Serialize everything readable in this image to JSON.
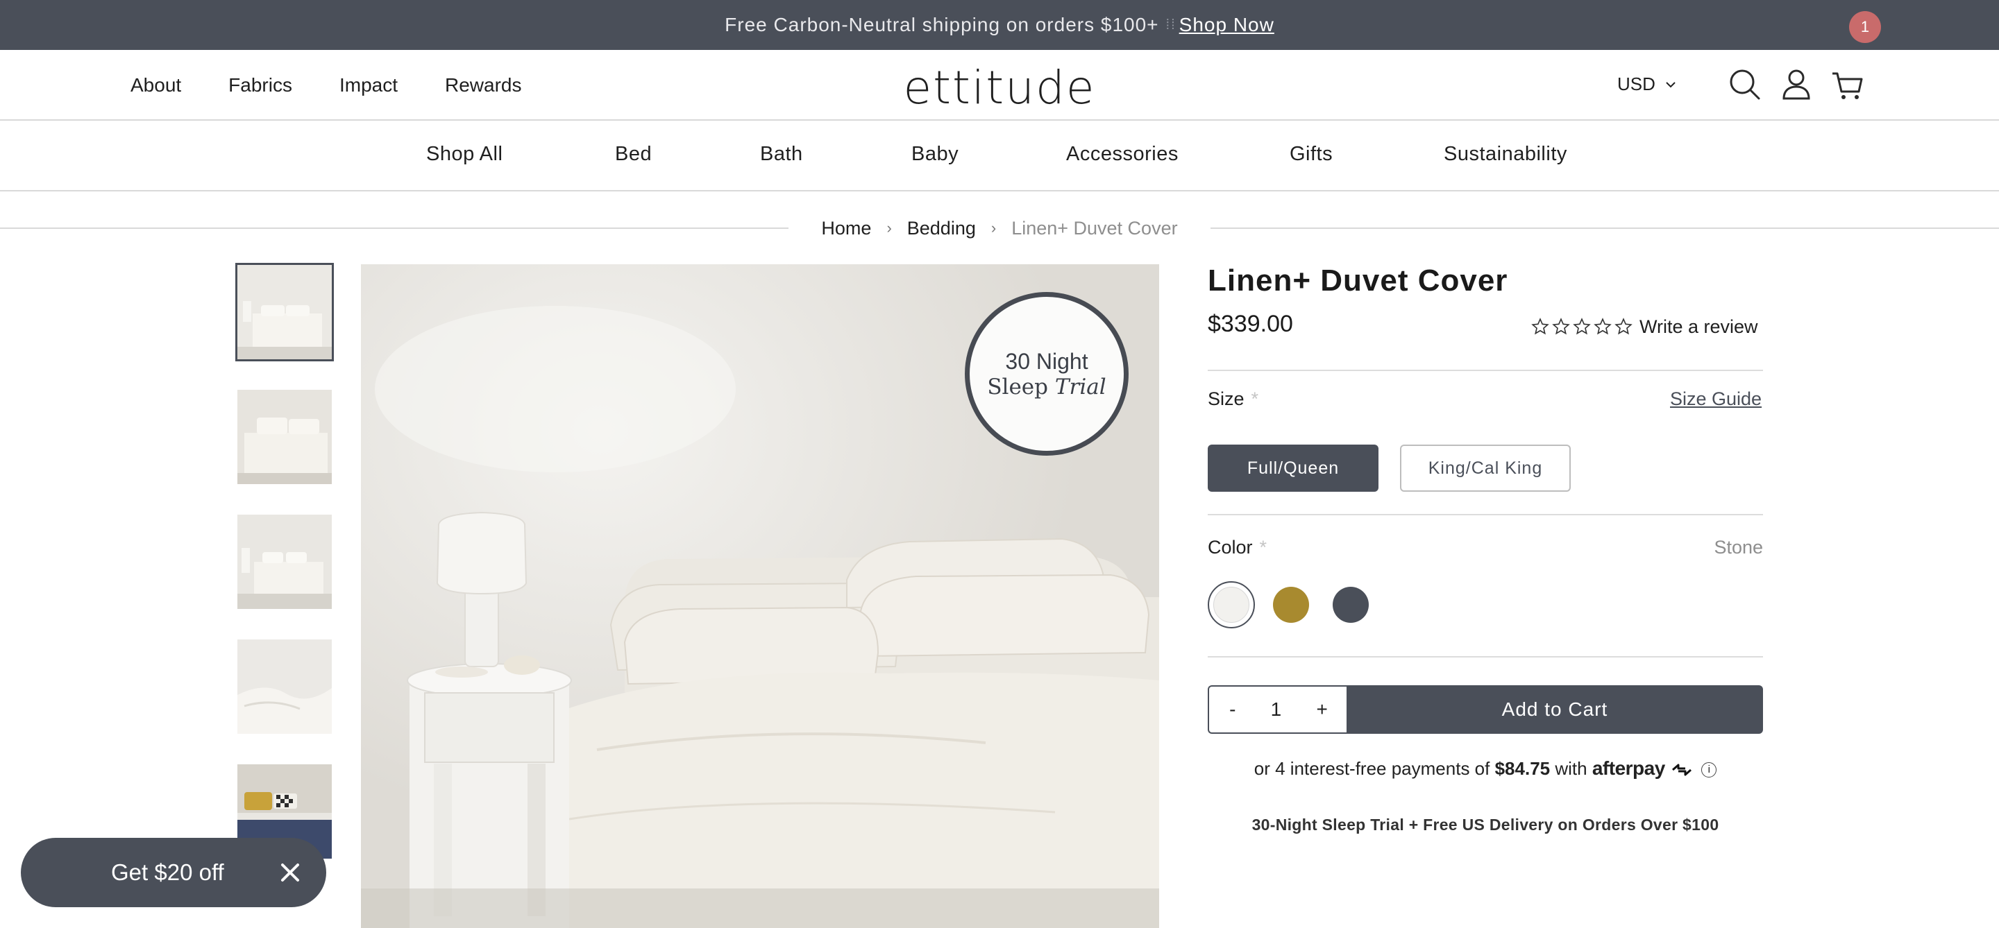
{
  "announcement": {
    "text": "Free Carbon-Neutral shipping on orders $100+",
    "link": "Shop Now"
  },
  "header": {
    "nav": [
      "About",
      "Fabrics",
      "Impact",
      "Rewards"
    ],
    "logo": "ettitude",
    "currency": "USD",
    "cart_count": "1"
  },
  "categories": [
    "Shop All",
    "Bed",
    "Bath",
    "Baby",
    "Accessories",
    "Gifts",
    "Sustainability"
  ],
  "breadcrumb": [
    "Home",
    "Bedding",
    "Linen+ Duvet Cover"
  ],
  "badge": {
    "line1": "30 Night",
    "line2a": "Sleep",
    "line2b": "Trial"
  },
  "product": {
    "title": "Linen+ Duvet Cover",
    "price": "$339.00",
    "rating_stars": 0,
    "write_review": "Write a review",
    "size_label": "Size",
    "required_mark": "*",
    "size_guide": "Size Guide",
    "sizes": [
      "Full/Queen",
      "King/Cal King"
    ],
    "selected_size": "Full/Queen",
    "color_label": "Color",
    "selected_color": "Stone",
    "swatches": [
      "#f2f1ee",
      "#a88a2f",
      "#4a4f59"
    ],
    "qty_minus": "-",
    "quantity": "1",
    "qty_plus": "+",
    "add_to_cart": "Add to Cart",
    "afterpay": {
      "prefix": "or 4 interest-free payments of",
      "amount": "$84.75",
      "with": "with",
      "brand": "afterpay"
    },
    "trial_note": "30-Night Sleep Trial + Free US Delivery on Orders Over $100"
  },
  "promo": {
    "text": "Get $20 off"
  },
  "colors": {
    "dark": "#4a4f59",
    "badge": "#c96b6b"
  }
}
